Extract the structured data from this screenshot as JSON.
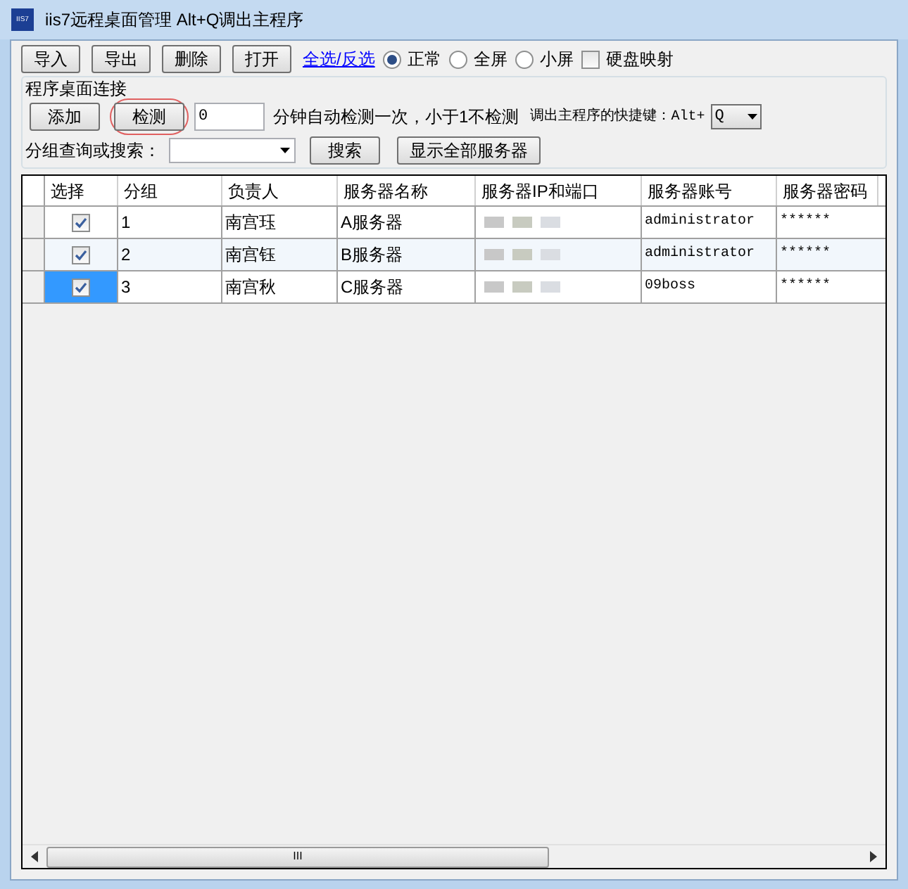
{
  "window": {
    "title": "iis7远程桌面管理 Alt+Q调出主程序",
    "icon_text": "IIS7"
  },
  "toolbar": {
    "buttons": [
      "导入",
      "导出",
      "删除",
      "打开"
    ],
    "link": "全选/反选",
    "modes": [
      {
        "label": "正常",
        "selected": true
      },
      {
        "label": "全屏",
        "selected": false
      },
      {
        "label": "小屏",
        "selected": false
      }
    ],
    "disk_mapping": {
      "label": "硬盘映射",
      "checked": false
    }
  },
  "group": {
    "title": "程序桌面连接",
    "buttons": [
      {
        "label": "添加",
        "highlighted": false
      },
      {
        "label": "检测",
        "highlighted": true
      }
    ],
    "interval": "0",
    "interval_hint": "分钟自动检测一次，小于1不检测",
    "hotkey_label": "调出主程序的快捷键：Alt+",
    "hotkey": "Q",
    "search_label": "分组查询或搜索：",
    "search_button": "搜索",
    "show_all_button": "显示全部服务器"
  },
  "table": {
    "columns": [
      "选择",
      "分组",
      "负责人",
      "服务器名称",
      "服务器IP和端口",
      "服务器账号",
      "服务器密码"
    ],
    "rows": [
      {
        "checked": true,
        "selected": false,
        "group": "1",
        "owner": "南宫珏",
        "name": "A服务器",
        "account": "administrator",
        "password": "******"
      },
      {
        "checked": true,
        "selected": false,
        "group": "2",
        "owner": "南宫钰",
        "name": "B服务器",
        "account": "administrator",
        "password": "******"
      },
      {
        "checked": true,
        "selected": true,
        "group": "3",
        "owner": "南宫秋",
        "name": "C服务器",
        "account": "09boss",
        "password": "******"
      }
    ]
  },
  "scrollbar_thumb": "III"
}
